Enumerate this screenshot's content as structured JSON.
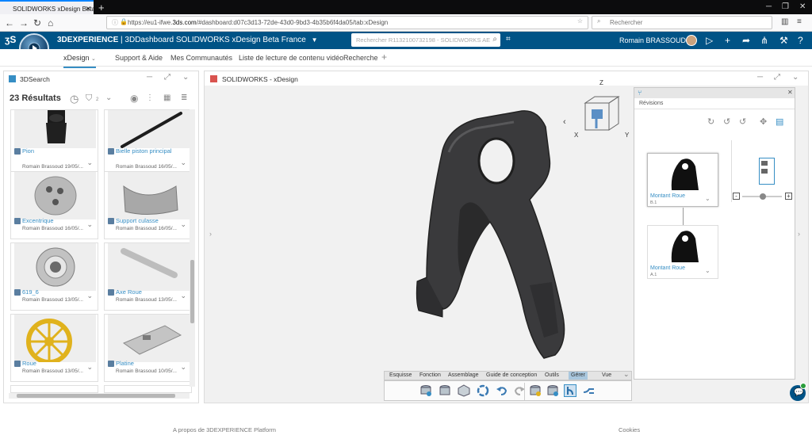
{
  "browser": {
    "tab_title": "SOLIDWORKS xDesign Beta Fr...",
    "url_prefix": "https://eu1-ifwe.",
    "url_host": "3ds.com",
    "url_rest": "/#dashboard:d07c3d13-72de-43d0-9bd3-4b35b6f4da05/tab:xDesign",
    "search_placeholder": "Rechercher"
  },
  "header": {
    "brand_bold": "3DEXPERIENCE",
    "brand_rest": " | 3DDashboard SOLIDWORKS xDesign Beta France",
    "search_placeholder": "Rechercher R1132100732198 - SOLIDWORKS AE",
    "user_name": "Romain BRASSOUD"
  },
  "tabs": [
    "xDesign",
    "Support & Aide",
    "Mes Communautés",
    "Liste de lecture de contenu vidéo",
    "Recherche"
  ],
  "search_panel": {
    "title": "3DSearch",
    "result_count": "23",
    "result_label": "Résultats",
    "filter_count": "2",
    "results": [
      {
        "name": "Pion",
        "meta": "Romain Brassoud 19/05/..."
      },
      {
        "name": "Bielle piston principal",
        "meta": "Romain Brassoud 16/05/..."
      },
      {
        "name": "Excentrique",
        "meta": "Romain Brassoud 16/05/..."
      },
      {
        "name": "Support culasse",
        "meta": "Romain Brassoud 16/05/..."
      },
      {
        "name": "619_6",
        "meta": "Romain Brassoud 13/05/..."
      },
      {
        "name": "Axe Roue",
        "meta": "Romain Brassoud 13/05/..."
      },
      {
        "name": "Roue",
        "meta": "Romain Brassoud 13/05/..."
      },
      {
        "name": "Platine",
        "meta": "Romain Brassoud 10/05/..."
      }
    ]
  },
  "design_panel": {
    "title": "SOLIDWORKS - xDesign",
    "axis_labels": {
      "x": "X",
      "y": "Y",
      "z": "Z"
    },
    "revisions_title": "Révisions",
    "revisions": [
      {
        "name": "Montant Roue",
        "version": "B.1"
      },
      {
        "name": "Montant Roue",
        "version": "A.1"
      }
    ],
    "context_tabs": [
      "Esquisse",
      "Fonction",
      "Assemblage",
      "Guide de conception",
      "Outils",
      "Gérer",
      "Vue"
    ],
    "active_context_tab": "Gérer"
  },
  "footer": {
    "about": "A propos de 3DEXPERIENCE Platform",
    "cookies": "Cookies"
  },
  "colors": {
    "brand_blue": "#005386",
    "link_blue": "#368ec4",
    "model_dark": "#3a3a3c"
  }
}
